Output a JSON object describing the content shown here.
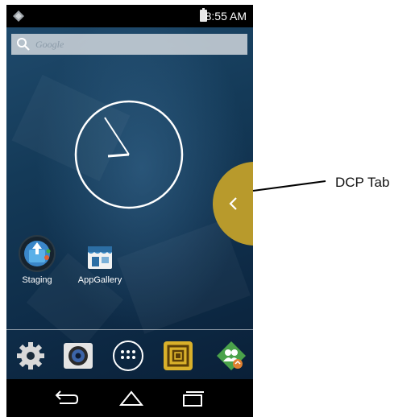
{
  "status_bar": {
    "time": "8:55 AM"
  },
  "search": {
    "placeholder": "Google"
  },
  "clock_widget": {
    "hour_hand": "10 o'clock",
    "minute_hand": "~54 min"
  },
  "apps": [
    {
      "label": "Staging",
      "icon": "staging-icon"
    },
    {
      "label": "AppGallery",
      "icon": "appgallery-icon"
    }
  ],
  "dock": [
    {
      "icon": "settings-gear-icon"
    },
    {
      "icon": "camera-icon"
    },
    {
      "icon": "app-drawer-icon"
    },
    {
      "icon": "dcp-scan-icon"
    },
    {
      "icon": "people-sync-icon"
    }
  ],
  "navigation": [
    "back-icon",
    "home-icon",
    "recents-icon"
  ],
  "callout": {
    "label": "DCP Tab"
  },
  "colors": {
    "dcp_tab": "#b89a2c",
    "wallpaper": "#143a58",
    "dock_highlight": "#d9b02a"
  }
}
